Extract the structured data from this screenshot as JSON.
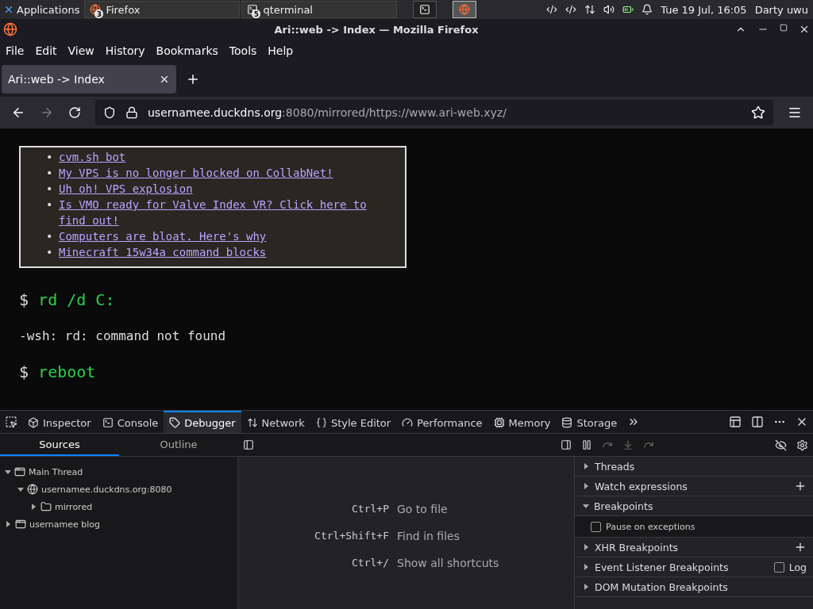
{
  "taskbar": {
    "launcher": "Applications",
    "tasks": [
      {
        "label": "Firefox",
        "count": "3",
        "kind": "browser",
        "selected": false
      },
      {
        "label": "qterminal",
        "count": "5",
        "kind": "terminal",
        "selected": false
      }
    ],
    "pinned": [
      {
        "kind": "terminal",
        "selected": false
      },
      {
        "kind": "browser",
        "selected": true
      }
    ],
    "clock": "Tue 19 Jul, 16:05",
    "user": "Darty uwu"
  },
  "window": {
    "title": "Ari::web -> Index — Mozilla Firefox"
  },
  "menu": [
    "File",
    "Edit",
    "View",
    "History",
    "Bookmarks",
    "Tools",
    "Help"
  ],
  "tabs": [
    {
      "label": "Ari::web -> Index",
      "selected": true
    }
  ],
  "address": {
    "host": "usernamee.duckdns.org",
    "rest": ":8080/mirrored/https://www.ari-web.xyz/"
  },
  "page": {
    "links": [
      {
        "bullet": "•",
        "text": "cvm.sh bot"
      },
      {
        "bullet": "•",
        "text": "My VPS is no longer blocked on CollabNet!"
      },
      {
        "bullet": "•",
        "text": "Uh oh! VPS explosion"
      },
      {
        "bullet": "•",
        "text": "Is VMO ready for Valve Index VR? Click here to find out!"
      },
      {
        "bullet": "•",
        "text": "Computers are bloat. Here's why"
      },
      {
        "bullet": "•",
        "text": "Minecraft 15w34a command blocks"
      }
    ],
    "terminal": [
      {
        "kind": "command",
        "prompt": "$",
        "text": "rd /d C:"
      },
      {
        "kind": "output",
        "text": "-wsh: rd: command not found"
      },
      {
        "kind": "command",
        "prompt": "$",
        "text": "reboot"
      }
    ]
  },
  "devtools": {
    "tools": [
      {
        "label": "Inspector",
        "selected": false
      },
      {
        "label": "Console",
        "selected": false
      },
      {
        "label": "Debugger",
        "selected": true
      },
      {
        "label": "Network",
        "selected": false
      },
      {
        "label": "Style Editor",
        "selected": false
      },
      {
        "label": "Performance",
        "selected": false
      },
      {
        "label": "Memory",
        "selected": false
      },
      {
        "label": "Storage",
        "selected": false
      }
    ],
    "source_tabs": [
      {
        "label": "Sources",
        "selected": true
      },
      {
        "label": "Outline",
        "selected": false
      }
    ],
    "tree": [
      {
        "label": "Main Thread",
        "kind": "thread",
        "expanded": true,
        "children": [
          {
            "label": "usernamee.duckdns.org:8080",
            "kind": "host",
            "expanded": true,
            "children": [
              {
                "label": "mirrored",
                "kind": "folder",
                "expanded": false
              }
            ]
          }
        ]
      },
      {
        "label": "usernamee blog",
        "kind": "thread",
        "expanded": false
      }
    ],
    "shortcuts": [
      {
        "keys": "Ctrl+P",
        "label": "Go to file"
      },
      {
        "keys": "Ctrl+Shift+F",
        "label": "Find in files"
      },
      {
        "keys": "Ctrl+/",
        "label": "Show all shortcuts"
      }
    ],
    "sections": [
      {
        "label": "Threads",
        "expanded": false
      },
      {
        "label": "Watch expressions",
        "expanded": false,
        "action": {
          "kind": "add"
        }
      },
      {
        "label": "Breakpoints",
        "expanded": true,
        "options": [
          {
            "label": "Pause on exceptions",
            "checked": false
          }
        ]
      },
      {
        "label": "XHR Breakpoints",
        "expanded": false,
        "action": {
          "kind": "add"
        }
      },
      {
        "label": "Event Listener Breakpoints",
        "expanded": false,
        "action": {
          "kind": "checkbox",
          "label": "Log",
          "checked": false
        }
      },
      {
        "label": "DOM Mutation Breakpoints",
        "expanded": false
      }
    ]
  }
}
